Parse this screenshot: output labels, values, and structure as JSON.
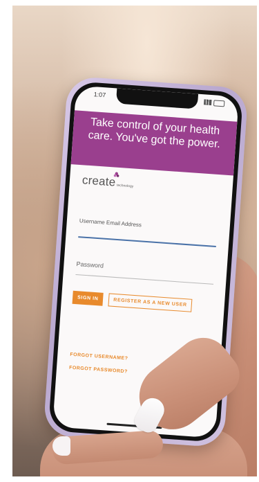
{
  "status_bar": {
    "time": "1:07"
  },
  "banner": {
    "text": "Take control of your health care. You've got the power."
  },
  "logo": {
    "word": "create",
    "subtext": "technology"
  },
  "form": {
    "username_label": "Username Email Address",
    "password_label": "Password",
    "sign_in_label": "SIGN IN",
    "register_label": "REGISTER AS A NEW USER"
  },
  "links": {
    "forgot_username": "FORGOT USERNAME?",
    "forgot_password": "FORGOT PASSWORD?"
  },
  "colors": {
    "banner": "#9a3f8e",
    "accent": "#e88a2c",
    "input_focus": "#4a72a8"
  }
}
